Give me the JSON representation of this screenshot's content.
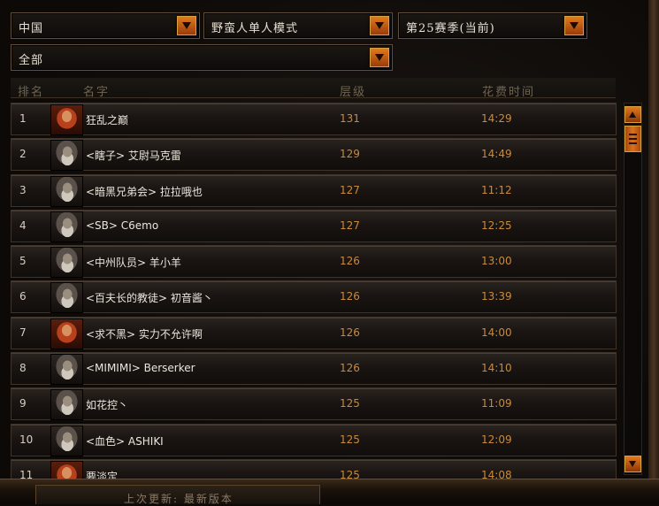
{
  "filters": {
    "region": "中国",
    "class_mode": "野蛮人单人模式",
    "season": "第25赛季(当前)",
    "category": "全部"
  },
  "table": {
    "headers": {
      "rank": "排名",
      "name": "名字",
      "level": "层级",
      "time": "花费时间"
    },
    "rows": [
      {
        "rank": "1",
        "name": "狂乱之巅",
        "level": "131",
        "time": "14:29",
        "avatar": "female-barbarian"
      },
      {
        "rank": "2",
        "name": "<瞎子> 艾尉马克雷",
        "level": "129",
        "time": "14:49",
        "avatar": "male-barbarian"
      },
      {
        "rank": "3",
        "name": "<暗黑兄弟会> 拉拉哦也",
        "level": "127",
        "time": "11:12",
        "avatar": "male-barbarian"
      },
      {
        "rank": "4",
        "name": "<SB> C6emo",
        "level": "127",
        "time": "12:25",
        "avatar": "male-barbarian"
      },
      {
        "rank": "5",
        "name": "<中州队员> 羊小羊",
        "level": "126",
        "time": "13:00",
        "avatar": "male-barbarian"
      },
      {
        "rank": "6",
        "name": "<百夫长的教徒> 初音酱丶",
        "level": "126",
        "time": "13:39",
        "avatar": "male-barbarian"
      },
      {
        "rank": "7",
        "name": "<求不黑> 实力不允许啊",
        "level": "126",
        "time": "14:00",
        "avatar": "female-barbarian"
      },
      {
        "rank": "8",
        "name": "<MIMIMI> Berserker",
        "level": "126",
        "time": "14:10",
        "avatar": "male-barbarian"
      },
      {
        "rank": "9",
        "name": "如花控丶",
        "level": "125",
        "time": "11:09",
        "avatar": "male-barbarian"
      },
      {
        "rank": "10",
        "name": "<血色> ASHIKI",
        "level": "125",
        "time": "12:09",
        "avatar": "male-barbarian"
      },
      {
        "rank": "11",
        "name": "要淡定",
        "level": "125",
        "time": "14:08",
        "avatar": "female-barbarian"
      }
    ]
  },
  "footer": {
    "last_update": "上次更新: 最新版本"
  },
  "colors": {
    "accent": "#c98a3a",
    "button": "#d8721e"
  }
}
